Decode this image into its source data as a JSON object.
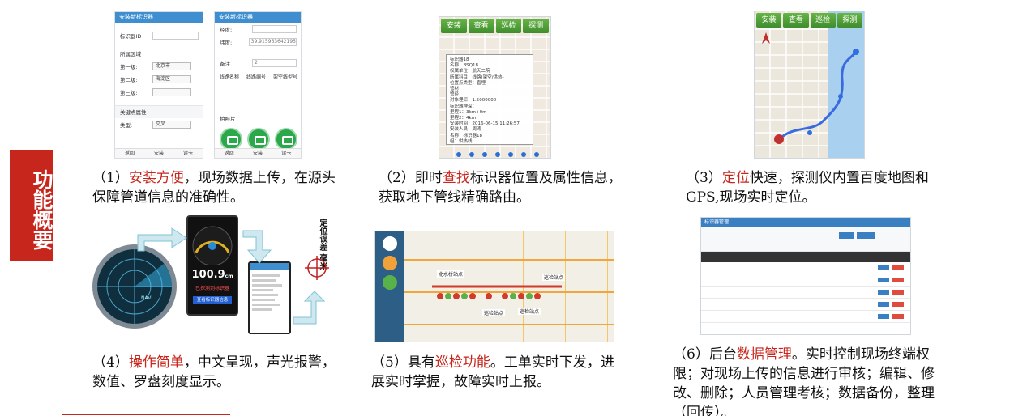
{
  "sidebar": {
    "label": "功能概要"
  },
  "captions": [
    {
      "num": "（1）",
      "hl": "安装方便",
      "rest": "，现场数据上传，在源头保障管道信息的准确性。"
    },
    {
      "num": "（2）即时",
      "hl": "查找",
      "rest": "标识器位置及属性信息，获取地下管线精确路由。"
    },
    {
      "num": "（3）",
      "hl": "定位",
      "rest": "快速，探测仪内置百度地图和GPS,现场实时定位。"
    },
    {
      "num": "（4）",
      "hl": "操作简单",
      "rest": "，中文呈现，声光报警，数值、罗盘刻度显示。"
    },
    {
      "num": "（5）具有",
      "hl": "巡检功能",
      "rest": "。工单实时下发，进展实时掌握，故障实时上报。"
    },
    {
      "num": "（6）后台",
      "hl": "数据管理",
      "rest": "。实时控制现场终端权限；对现场上传的信息进行审核；编辑、修改、删除；人员管理考核；数据备份，整理（回传）。"
    }
  ],
  "screen1": {
    "title": "安装新标识器",
    "id_label": "标识器ID",
    "region_label": "所属区域",
    "level1_label": "第一级:",
    "level1_value": "北京市",
    "level2_label": "第二级:",
    "level2_value": "海淀区",
    "level3_label": "第三级:",
    "keypoint_label": "关键点属性",
    "type_label": "类型:",
    "type_value": "交叉",
    "footer": [
      "返回",
      "安装",
      "读卡"
    ]
  },
  "screen2": {
    "title": "安装新标识器",
    "lon_label": "经度:",
    "lat_label": "纬度:",
    "lat_value": "39.915963642195",
    "remark_label": "备注",
    "remark_value": "2",
    "col1": "线路名称",
    "col2": "线路编号",
    "col3": "架空线型号",
    "photo_label": "拍照片",
    "footer": [
      "返回",
      "安装",
      "读卡"
    ]
  },
  "map_tabs": [
    "安装",
    "查看",
    "巡检",
    "探测"
  ],
  "popup": {
    "lines": [
      "标识器18",
      "名称：BSQ18",
      "权属单位：航天二院",
      "所属科目：线路(架空/供热)",
      "位置点类型：直埋",
      "管材：",
      "管径：",
      "对象埋深：1.5000000",
      "标识器埋深：",
      "里程1：3km+0m",
      "里程2：4km",
      "安装时间：2016-06-15 11:26:57",
      "安装人员：周涛",
      "名称：标识器18",
      "组：供热线"
    ]
  },
  "device": {
    "reading": "100.9",
    "unit": "cm",
    "alert": "已探测到标识器",
    "button": "查看标识器信息"
  },
  "compass_text": "NAVI",
  "vertical_text": "定位误差 毫米",
  "patrol_labels": [
    "北水桥站点",
    "巡检站点",
    "巡检站点",
    "巡检站点"
  ],
  "dashboard": {
    "title": "标识器管理"
  }
}
